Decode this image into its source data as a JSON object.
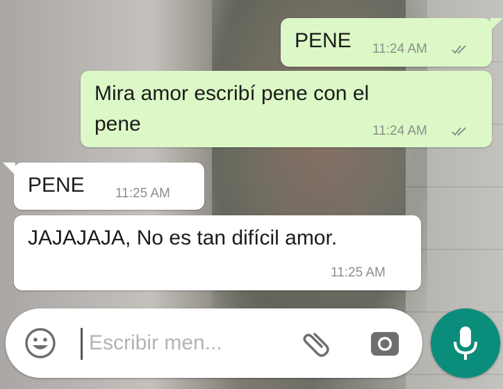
{
  "chat": {
    "messages": [
      {
        "direction": "outgoing",
        "text": "PENE",
        "time": "11:24 AM",
        "status": "read"
      },
      {
        "direction": "outgoing",
        "text_line1": "Mira amor escribí pene con el",
        "text_line2": "pene",
        "time": "11:24 AM",
        "status": "read"
      },
      {
        "direction": "incoming",
        "text": "PENE",
        "time": "11:25 AM"
      },
      {
        "direction": "incoming",
        "text": "JAJAJAJA, No es tan difícil amor.",
        "time": "11:25 AM"
      }
    ]
  },
  "composer": {
    "placeholder": "Escribir men...",
    "emoji_icon": "emoji-icon",
    "attach_icon": "paperclip-icon",
    "camera_icon": "camera-icon",
    "mic_icon": "microphone-icon"
  },
  "colors": {
    "outgoing_bubble": "#dcf8c6",
    "incoming_bubble": "#ffffff",
    "mic_button": "#0a8d7b",
    "meta_text": "#8a8f8a"
  }
}
